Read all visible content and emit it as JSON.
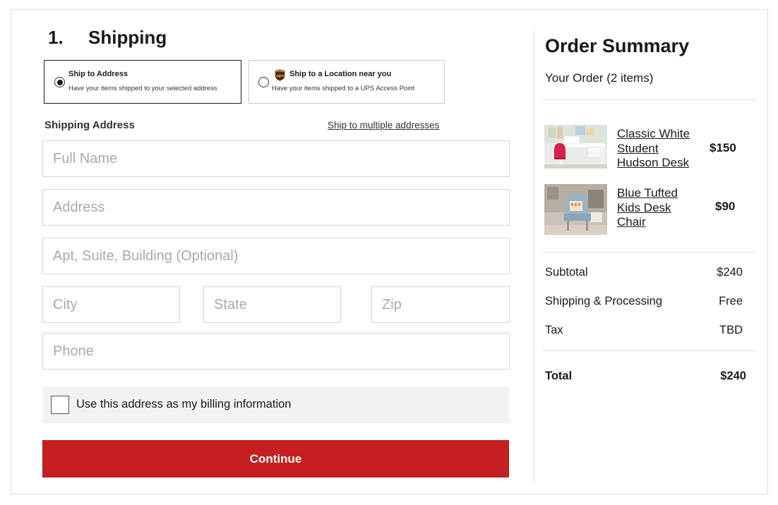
{
  "shipping": {
    "step_number": "1.",
    "step_title": "Shipping",
    "options": [
      {
        "title": "Ship to Address",
        "subtitle": "Have your items shipped to your selected address",
        "selected": true
      },
      {
        "title": "Ship to a Location near you",
        "subtitle": "Have your items shipped to a UPS Access Point",
        "selected": false,
        "icon": "ups-logo-icon"
      }
    ],
    "section_label": "Shipping Address",
    "multi_link": "Ship to multiple addresses",
    "fields": {
      "full_name": {
        "placeholder": "Full Name",
        "value": ""
      },
      "address": {
        "placeholder": "Address",
        "value": ""
      },
      "apt": {
        "placeholder": "Apt, Suite, Building (Optional)",
        "value": ""
      },
      "city": {
        "placeholder": "City",
        "value": ""
      },
      "state": {
        "placeholder": "State",
        "value": ""
      },
      "zip": {
        "placeholder": "Zip",
        "value": ""
      },
      "phone": {
        "placeholder": "Phone",
        "value": ""
      }
    },
    "billing_checkbox": {
      "label": "Use this address as my billing information",
      "checked": false
    },
    "continue_label": "Continue",
    "accent_color": "#c5201f"
  },
  "summary": {
    "title": "Order Summary",
    "count": "Your Order (2 items)",
    "items": [
      {
        "name_lines": [
          "Classic White",
          "Student",
          "Hudson Desk"
        ],
        "price": "$150",
        "image": "desk-product-photo"
      },
      {
        "name_lines": [
          "Blue Tufted",
          "Kids Desk",
          "Chair"
        ],
        "price": "$90",
        "image": "chair-product-photo"
      }
    ],
    "rows": [
      {
        "label": "Subtotal",
        "value": "$240"
      },
      {
        "label": "Shipping & Processing",
        "value": "Free"
      },
      {
        "label": "Tax",
        "value": "TBD"
      }
    ],
    "total": {
      "label": "Total",
      "value": "$240"
    }
  }
}
